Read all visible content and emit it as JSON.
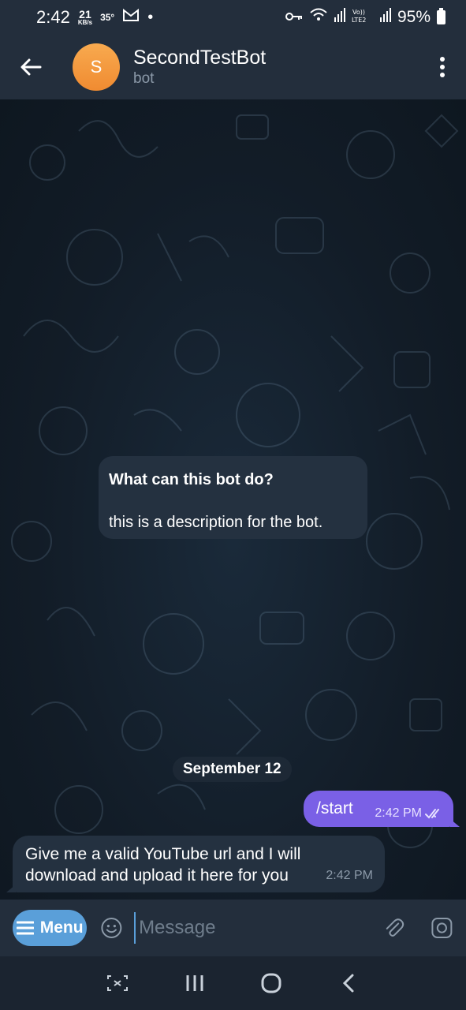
{
  "status_bar": {
    "time": "2:42",
    "speed_value": "21",
    "speed_unit": "KB/s",
    "temperature": "35°",
    "dot": "•",
    "battery": "95%"
  },
  "header": {
    "avatar_letter": "S",
    "title": "SecondTestBot",
    "subtitle": "bot"
  },
  "bot_info": {
    "title": "What can this bot do?",
    "description": "this is a description for the bot."
  },
  "date_separator": "September 12",
  "messages": [
    {
      "direction": "out",
      "text": "/start",
      "time": "2:42 PM",
      "status": "read"
    },
    {
      "direction": "in",
      "text": "Give me a valid YouTube url and I will download and upload it here for you",
      "time": "2:42 PM"
    }
  ],
  "composer": {
    "menu_label": "Menu",
    "placeholder": "Message"
  },
  "colors": {
    "header_bg": "#232e3c",
    "accent": "#5a9fd9",
    "outgoing_bubble": "#7a60e6",
    "incoming_bubble": "#243140",
    "avatar": "#f5a044"
  }
}
